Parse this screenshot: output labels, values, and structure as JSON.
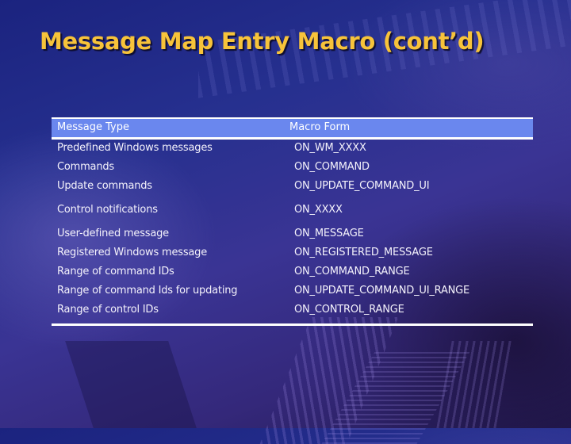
{
  "slide": {
    "title": "Message Map Entry Macro (cont’d)"
  },
  "table": {
    "headers": [
      "Message Type",
      "Macro Form"
    ],
    "rows": [
      {
        "type": "Predefined Windows messages",
        "macro": "ON_WM_XXXX"
      },
      {
        "type": "Commands",
        "macro": "ON_COMMAND"
      },
      {
        "type": "Update commands",
        "macro": "ON_UPDATE_COMMAND_UI"
      },
      {
        "type": "Control notifications",
        "macro": "ON_XXXX"
      },
      {
        "type": "User-defined message",
        "macro": "ON_MESSAGE"
      },
      {
        "type": "Registered Windows message",
        "macro": "ON_REGISTERED_MESSAGE"
      },
      {
        "type": "Range of command IDs",
        "macro": "ON_COMMAND_RANGE"
      },
      {
        "type": "Range of command Ids for updating",
        "macro": "ON_UPDATE_COMMAND_UI_RANGE"
      },
      {
        "type": "Range of control IDs",
        "macro": "ON_CONTROL_RANGE"
      }
    ]
  },
  "colors": {
    "title": "#f7c33a",
    "header_fill": "#6a87ee",
    "rule": "#ffffff",
    "text": "#ffffff"
  }
}
